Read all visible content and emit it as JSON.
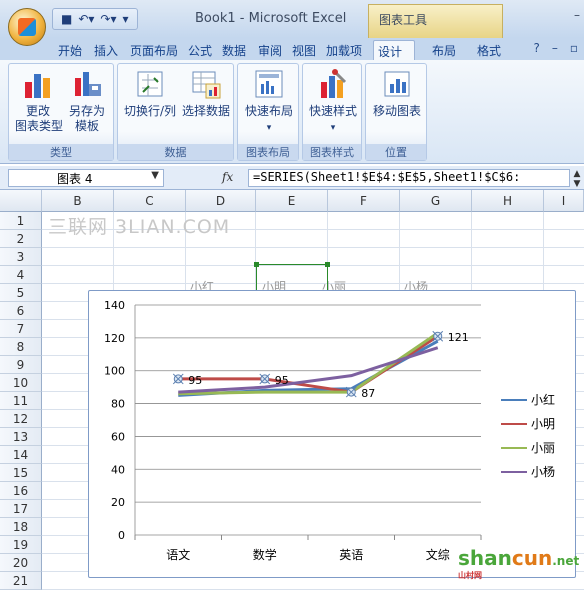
{
  "titlebar": {
    "window_title": "Book1 - Microsoft Excel",
    "context_tools": "图表工具"
  },
  "tabs": [
    {
      "label": "开始"
    },
    {
      "label": "插入"
    },
    {
      "label": "页面布局"
    },
    {
      "label": "公式"
    },
    {
      "label": "数据"
    },
    {
      "label": "审阅"
    },
    {
      "label": "视图"
    },
    {
      "label": "加载项"
    },
    {
      "label": "设计"
    },
    {
      "label": "布局"
    },
    {
      "label": "格式"
    }
  ],
  "ribbon": {
    "groups": [
      {
        "label": "类型",
        "buttons": [
          {
            "label": "更改\n图表类型"
          },
          {
            "label": "另存为\n模板"
          }
        ]
      },
      {
        "label": "数据",
        "buttons": [
          {
            "label": "切换行/列"
          },
          {
            "label": "选择数据"
          }
        ]
      },
      {
        "label": "图表布局",
        "buttons": [
          {
            "label": "快速布局"
          }
        ]
      },
      {
        "label": "图表样式",
        "buttons": [
          {
            "label": "快速样式"
          }
        ]
      },
      {
        "label": "位置",
        "buttons": [
          {
            "label": "移动图表"
          }
        ]
      }
    ]
  },
  "formula_bar": {
    "name_box": "图表 4",
    "fx": "fx",
    "formula": "=SERIES(Sheet1!$E$4:$E$5,Sheet1!$C$6:"
  },
  "sheet": {
    "columns": [
      "B",
      "C",
      "D",
      "E",
      "F",
      "G",
      "H",
      "I"
    ],
    "rows": [
      "1",
      "2",
      "3",
      "4",
      "5",
      "6",
      "7",
      "8",
      "9",
      "10",
      "11",
      "12",
      "13",
      "14",
      "15",
      "16",
      "17",
      "18",
      "19",
      "20",
      "21"
    ],
    "behind_chart": [
      "小红",
      "小明",
      "小丽",
      "小杨"
    ]
  },
  "watermark": "三联网 3LIAN.COM",
  "site_logo": {
    "main": "shan",
    "accent": "cun",
    "suffix": ".net",
    "small": "山村网"
  },
  "chart_data": {
    "type": "line",
    "categories": [
      "语文",
      "数学",
      "英语",
      "文综"
    ],
    "ylim": [
      0,
      140
    ],
    "yticks": [
      0,
      20,
      40,
      60,
      80,
      100,
      120,
      140
    ],
    "legend_position": "right",
    "series": [
      {
        "name": "小红",
        "color": "#4a7ebb",
        "values": [
          85,
          88,
          89,
          118
        ]
      },
      {
        "name": "小明",
        "color": "#be4b48",
        "values": [
          95,
          95,
          87,
          121
        ]
      },
      {
        "name": "小丽",
        "color": "#98b954",
        "values": [
          86,
          87,
          87,
          123
        ]
      },
      {
        "name": "小杨",
        "color": "#7d60a0",
        "values": [
          87,
          90,
          97,
          114
        ]
      }
    ],
    "data_labels": [
      {
        "series": "小明",
        "point": 0,
        "text": "95"
      },
      {
        "series": "小明",
        "point": 1,
        "text": "95"
      },
      {
        "series": "小明",
        "point": 2,
        "text": "87"
      },
      {
        "series": "小明",
        "point": 3,
        "text": "121"
      }
    ]
  }
}
